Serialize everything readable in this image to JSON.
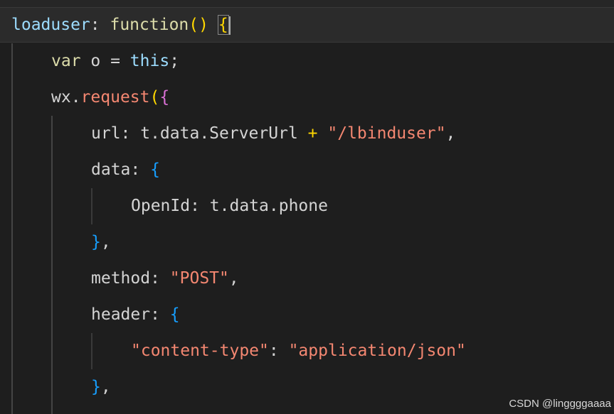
{
  "code_lines": [
    {
      "indent": 0,
      "tokens": [
        {
          "text": "loaduser",
          "color": "#9cdcfe"
        },
        {
          "text": ": ",
          "color": "#d4d4d4"
        },
        {
          "text": "function",
          "color": "#dcdcaa"
        },
        {
          "text": "()",
          "color": "#ffd700"
        },
        {
          "text": " ",
          "color": "#d4d4d4"
        },
        {
          "text": "{",
          "color": "#ffd700",
          "boxed": true
        }
      ]
    },
    {
      "indent": 1,
      "tokens": [
        {
          "text": "var",
          "color": "#dcdcaa"
        },
        {
          "text": " o = ",
          "color": "#d4d4d4"
        },
        {
          "text": "this",
          "color": "#9cdcfe"
        },
        {
          "text": ";",
          "color": "#d4d4d4"
        }
      ]
    },
    {
      "indent": 1,
      "tokens": [
        {
          "text": "wx",
          "color": "#d4d4d4"
        },
        {
          "text": ".",
          "color": "#d4d4d4"
        },
        {
          "text": "request",
          "color": "#f48771"
        },
        {
          "text": "(",
          "color": "#ffd700"
        },
        {
          "text": "{",
          "color": "#da70d6"
        }
      ]
    },
    {
      "indent": 2,
      "tokens": [
        {
          "text": "url",
          "color": "#d4d4d4"
        },
        {
          "text": ": t.data.ServerUrl ",
          "color": "#d4d4d4"
        },
        {
          "text": "+",
          "color": "#ffd700"
        },
        {
          "text": " ",
          "color": "#d4d4d4"
        },
        {
          "text": "\"/lbinduser\"",
          "color": "#f48771"
        },
        {
          "text": ",",
          "color": "#d4d4d4"
        }
      ]
    },
    {
      "indent": 2,
      "tokens": [
        {
          "text": "data",
          "color": "#d4d4d4"
        },
        {
          "text": ": ",
          "color": "#d4d4d4"
        },
        {
          "text": "{",
          "color": "#179fff"
        }
      ]
    },
    {
      "indent": 3,
      "tokens": [
        {
          "text": "OpenId",
          "color": "#d4d4d4"
        },
        {
          "text": ": t.data.phone",
          "color": "#d4d4d4"
        }
      ]
    },
    {
      "indent": 2,
      "tokens": [
        {
          "text": "}",
          "color": "#179fff"
        },
        {
          "text": ",",
          "color": "#d4d4d4"
        }
      ]
    },
    {
      "indent": 2,
      "tokens": [
        {
          "text": "method",
          "color": "#d4d4d4"
        },
        {
          "text": ": ",
          "color": "#d4d4d4"
        },
        {
          "text": "\"POST\"",
          "color": "#f48771"
        },
        {
          "text": ",",
          "color": "#d4d4d4"
        }
      ]
    },
    {
      "indent": 2,
      "tokens": [
        {
          "text": "header",
          "color": "#d4d4d4"
        },
        {
          "text": ": ",
          "color": "#d4d4d4"
        },
        {
          "text": "{",
          "color": "#179fff"
        }
      ]
    },
    {
      "indent": 3,
      "tokens": [
        {
          "text": "\"content-type\"",
          "color": "#f48771"
        },
        {
          "text": ": ",
          "color": "#d4d4d4"
        },
        {
          "text": "\"application/json\"",
          "color": "#f48771"
        }
      ]
    },
    {
      "indent": 2,
      "tokens": [
        {
          "text": "}",
          "color": "#179fff"
        },
        {
          "text": ",",
          "color": "#d4d4d4"
        }
      ]
    }
  ],
  "watermark": "CSDN @linggggaaaa",
  "theme": {
    "background": "#1e1e1e",
    "current_line": "#2b2b2b",
    "guide": "#444444"
  }
}
